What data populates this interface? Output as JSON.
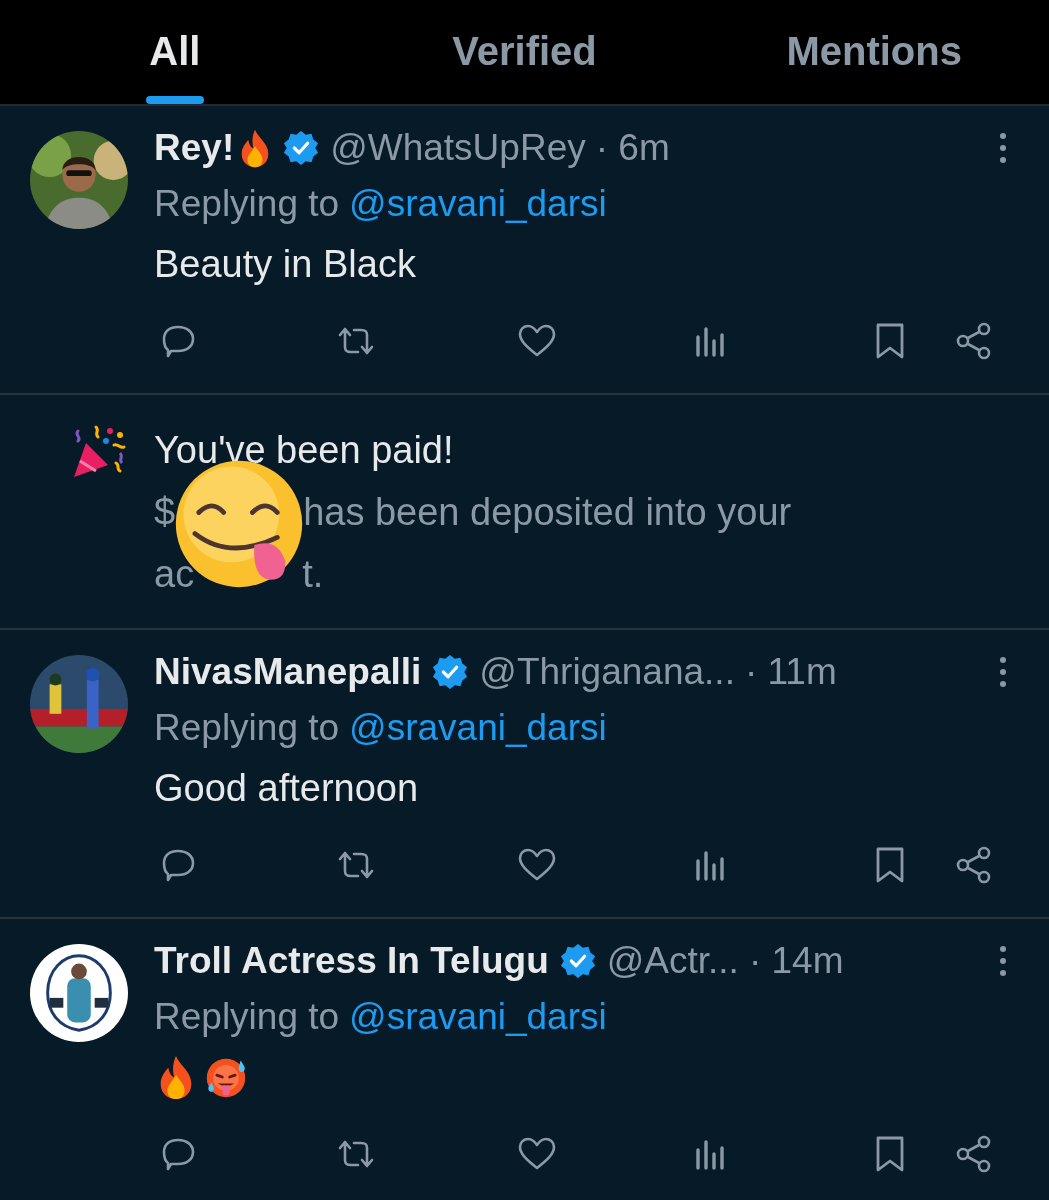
{
  "tabs": [
    {
      "label": "All",
      "selected": true
    },
    {
      "label": "Verified",
      "selected": false
    },
    {
      "label": "Mentions",
      "selected": false
    }
  ],
  "items": [
    {
      "kind": "tweet",
      "name": "Rey!",
      "verified": true,
      "handle": "@WhatsUpRey",
      "time": "· 6m",
      "replying_label": "Replying to",
      "replying_to": "@sravani_darsi",
      "text": "Beauty in Black"
    },
    {
      "kind": "notification",
      "title": "You've been paid!",
      "body_lines": [
        [
          "$",
          "has been deposited into your"
        ],
        [
          "ac",
          "t."
        ]
      ]
    },
    {
      "kind": "tweet",
      "name": "NivasManepalli",
      "verified": true,
      "handle": "@Thriganana...",
      "time": "· 11m",
      "replying_label": "Replying to",
      "replying_to": "@sravani_darsi",
      "text": "Good afternoon"
    },
    {
      "kind": "tweet",
      "name": "Troll Actress In Telugu",
      "verified": true,
      "handle": "@Actr...",
      "time": "· 14m",
      "replying_label": "Replying to",
      "replying_to": "@sravani_darsi"
    }
  ]
}
